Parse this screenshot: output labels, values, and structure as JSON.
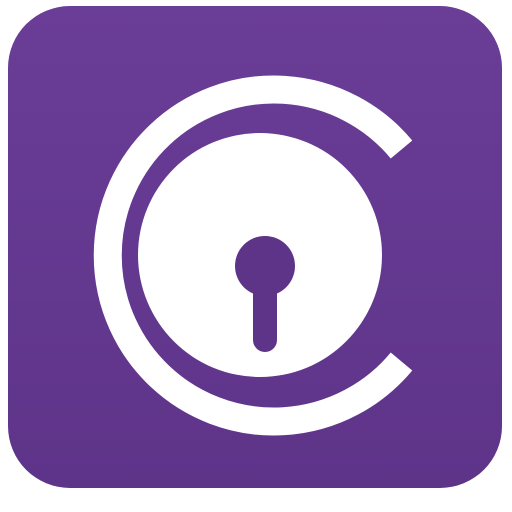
{
  "app_icon": {
    "tile_color_top": "#6a3d97",
    "tile_color_bottom": "#5e3489",
    "glyph_color": "#ffffff",
    "icons": {
      "tile": "app-tile-background",
      "ring": "c-ring-icon",
      "disc": "lock-disc-icon",
      "keyhole": "keyhole-icon"
    }
  }
}
